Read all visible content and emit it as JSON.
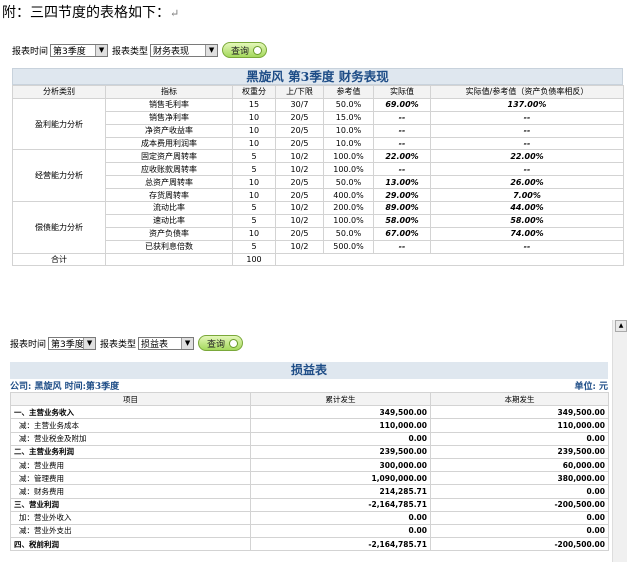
{
  "intro_text": "附：三四节度的表格如下：",
  "intro_return_mark": "↵",
  "filter1": {
    "period_label": "报表时间",
    "period_value": "第3季度",
    "type_label": "报表类型",
    "type_value": "财务表现",
    "query_label": "查询"
  },
  "table1": {
    "title": "黑旋风  第3季度  财务表现",
    "headers": [
      "分析类别",
      "指标",
      "权重分",
      "上/下限",
      "参考值",
      "实际值",
      "实际值/参考值（资产负债率相反）"
    ],
    "groups": [
      {
        "name": "盈利能力分析",
        "rows": [
          [
            "销售毛利率",
            "15",
            "30/7",
            "50.0%",
            "69.00%",
            "137.00%"
          ],
          [
            "销售净利率",
            "10",
            "20/5",
            "15.0%",
            "--",
            "--"
          ],
          [
            "净资产收益率",
            "10",
            "20/5",
            "10.0%",
            "--",
            "--"
          ],
          [
            "成本费用利润率",
            "10",
            "20/5",
            "10.0%",
            "--",
            "--"
          ]
        ]
      },
      {
        "name": "经营能力分析",
        "rows": [
          [
            "固定资产周转率",
            "5",
            "10/2",
            "100.0%",
            "22.00%",
            "22.00%"
          ],
          [
            "应收账款周转率",
            "5",
            "10/2",
            "100.0%",
            "--",
            "--"
          ],
          [
            "总资产周转率",
            "10",
            "20/5",
            "50.0%",
            "13.00%",
            "26.00%"
          ],
          [
            "存货周转率",
            "10",
            "20/5",
            "400.0%",
            "29.00%",
            "7.00%"
          ]
        ]
      },
      {
        "name": "偿债能力分析",
        "rows": [
          [
            "流动比率",
            "5",
            "10/2",
            "200.0%",
            "89.00%",
            "44.00%"
          ],
          [
            "速动比率",
            "5",
            "10/2",
            "100.0%",
            "58.00%",
            "58.00%"
          ],
          [
            "资产负债率",
            "10",
            "20/5",
            "50.0%",
            "67.00%",
            "74.00%"
          ],
          [
            "已获利息倍数",
            "5",
            "10/2",
            "500.0%",
            "--",
            "--"
          ]
        ]
      }
    ],
    "total_label": "合计",
    "total_weight": "100"
  },
  "filter2": {
    "period_label": "报表时间",
    "period_value": "第3季度",
    "type_label": "报表类型",
    "type_value": "损益表",
    "query_label": "查询"
  },
  "table2": {
    "title": "损益表",
    "company": "公司: 黑旋风  时间:第3季度",
    "unit": "单位: 元",
    "headers": [
      "项目",
      "累计发生",
      "本期发生"
    ],
    "rows": [
      {
        "item": "一、主营业务收入",
        "bold": true,
        "cum": "349,500.00",
        "cur": "349,500.00"
      },
      {
        "item": "减：主营业务成本",
        "bold": false,
        "cum": "110,000.00",
        "cur": "110,000.00"
      },
      {
        "item": "减：营业税金及附加",
        "bold": false,
        "cum": "0.00",
        "cur": "0.00"
      },
      {
        "item": "二、主营业务利润",
        "bold": true,
        "cum": "239,500.00",
        "cur": "239,500.00"
      },
      {
        "item": "减：营业费用",
        "bold": false,
        "cum": "300,000.00",
        "cur": "60,000.00"
      },
      {
        "item": "减：管理费用",
        "bold": false,
        "cum": "1,090,000.00",
        "cur": "380,000.00"
      },
      {
        "item": "减：财务费用",
        "bold": false,
        "cum": "214,285.71",
        "cur": "0.00"
      },
      {
        "item": "三、营业利润",
        "bold": true,
        "cum": "-2,164,785.71",
        "cur": "-200,500.00"
      },
      {
        "item": "加：营业外收入",
        "bold": false,
        "cum": "0.00",
        "cur": "0.00"
      },
      {
        "item": "减：营业外支出",
        "bold": false,
        "cum": "0.00",
        "cur": "0.00"
      },
      {
        "item": "四、税前利润",
        "bold": true,
        "cum": "-2,164,785.71",
        "cur": "-200,500.00"
      }
    ]
  }
}
